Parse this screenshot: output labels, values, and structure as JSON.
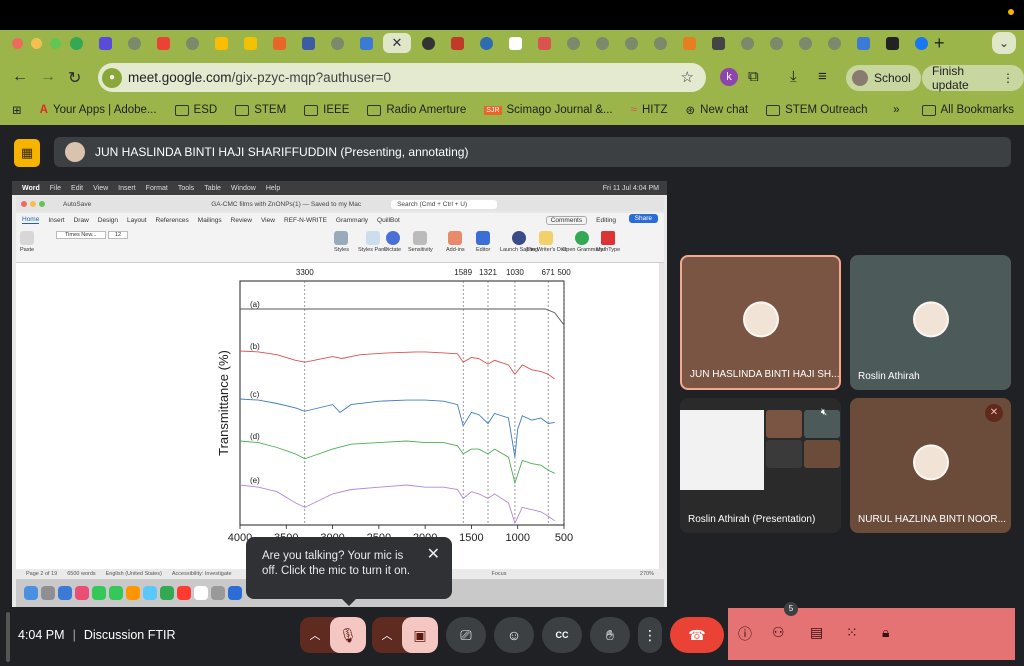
{
  "browser": {
    "url_host": "meet.google.com",
    "url_path": "/gix-pzyc-mqp?authuser=0",
    "profile_label": "School",
    "update_label": "Finish update",
    "extension_k": "k"
  },
  "bookmarks": [
    {
      "label": "Your Apps | Adobe..."
    },
    {
      "label": "ESD"
    },
    {
      "label": "STEM"
    },
    {
      "label": "IEEE"
    },
    {
      "label": "Radio Amerture"
    },
    {
      "label": "Scimago Journal &..."
    },
    {
      "label": "HITZ"
    },
    {
      "label": "New chat"
    },
    {
      "label": "STEM Outreach"
    }
  ],
  "bookmarks_more": "»",
  "all_bookmarks": "All Bookmarks",
  "presenting": {
    "label": "JUN HASLINDA BINTI HAJI SHARIFFUDDIN (Presenting, annotating)"
  },
  "shared_screen": {
    "mac_menu": [
      "Word",
      "File",
      "Edit",
      "View",
      "Insert",
      "Format",
      "Tools",
      "Table",
      "Window",
      "Help"
    ],
    "mac_clock": "Fri 11 Jul 4:04 PM",
    "doc_title": "GA-CMC films with ZnONPs(1) — Saved to my Mac",
    "autosave": "AutoSave",
    "search": "Search (Cmd + Ctrl + U)",
    "ribbon_tabs": [
      "Home",
      "Insert",
      "Draw",
      "Design",
      "Layout",
      "References",
      "Mailings",
      "Review",
      "View",
      "REF-N-WRITE",
      "Grammarly",
      "QuillBot"
    ],
    "comments": "Comments",
    "editing": "Editing",
    "share": "Share",
    "font_name": "Times New...",
    "font_size": "12",
    "ribbon_groups": [
      "Paste",
      "Styles",
      "Styles Pane",
      "Dictate",
      "Sensitivity",
      "Add-ins",
      "Editor",
      "Launch Sapling",
      "The Writer's Diet",
      "Open Grammary",
      "MathType"
    ],
    "status_page": "Page 2 of 19",
    "status_words": "6500 words",
    "status_lang": "English (United States)",
    "status_access": "Accessibility: Investigate",
    "status_focus": "Focus",
    "status_zoom": "270%"
  },
  "chart_data": {
    "type": "line",
    "title": "",
    "xlabel": "",
    "ylabel": "Transmittance (%)",
    "xlim": [
      4000,
      500
    ],
    "x_ticks": [
      4000,
      3500,
      3000,
      2500,
      2000,
      1500,
      1000,
      500
    ],
    "peak_markers": [
      3300,
      1589,
      1321,
      1030,
      671,
      500
    ],
    "series": [
      {
        "name": "(a)",
        "color": "#555555",
        "x": [
          4000,
          3500,
          3000,
          2500,
          2000,
          1500,
          1000,
          800,
          700,
          600,
          500
        ],
        "y": [
          0.93,
          0.93,
          0.93,
          0.93,
          0.93,
          0.93,
          0.93,
          0.93,
          0.93,
          0.9,
          0.8
        ]
      },
      {
        "name": "(b)",
        "color": "#d9534f",
        "x": [
          4000,
          3800,
          3600,
          3400,
          3300,
          3200,
          3000,
          2900,
          2700,
          2400,
          2100,
          2000,
          1800,
          1650,
          1589,
          1500,
          1420,
          1321,
          1250,
          1100,
          1030,
          950,
          850,
          750,
          671,
          600
        ],
        "y": [
          0.8,
          0.79,
          0.76,
          0.7,
          0.68,
          0.7,
          0.74,
          0.72,
          0.76,
          0.78,
          0.79,
          0.79,
          0.78,
          0.77,
          0.68,
          0.73,
          0.72,
          0.66,
          0.7,
          0.65,
          0.55,
          0.65,
          0.6,
          0.58,
          0.55,
          0.5
        ]
      },
      {
        "name": "(c)",
        "color": "#3d7cc9",
        "x": [
          4000,
          3800,
          3600,
          3400,
          3300,
          3200,
          3000,
          2920,
          2800,
          2500,
          2200,
          2000,
          1800,
          1650,
          1589,
          1500,
          1420,
          1321,
          1250,
          1100,
          1030,
          1000,
          950,
          850,
          750,
          671,
          600
        ],
        "y": [
          0.57,
          0.56,
          0.53,
          0.49,
          0.46,
          0.48,
          0.52,
          0.45,
          0.52,
          0.55,
          0.56,
          0.56,
          0.55,
          0.52,
          0.33,
          0.45,
          0.43,
          0.35,
          0.44,
          0.4,
          0.05,
          0.3,
          0.42,
          0.38,
          0.4,
          0.35,
          0.36
        ]
      },
      {
        "name": "(d)",
        "color": "#4caf50",
        "x": [
          4000,
          3800,
          3600,
          3400,
          3300,
          3200,
          3000,
          2800,
          2500,
          2200,
          2000,
          1800,
          1650,
          1589,
          1500,
          1420,
          1321,
          1250,
          1100,
          1030,
          950,
          850,
          750,
          671,
          600
        ],
        "y": [
          0.38,
          0.37,
          0.34,
          0.3,
          0.27,
          0.29,
          0.33,
          0.36,
          0.37,
          0.38,
          0.37,
          0.37,
          0.35,
          0.3,
          0.33,
          0.33,
          0.3,
          0.33,
          0.28,
          0.12,
          0.26,
          0.24,
          0.23,
          0.2,
          0.18
        ]
      },
      {
        "name": "(e)",
        "color": "#b388d6",
        "x": [
          4000,
          3800,
          3600,
          3400,
          3300,
          3200,
          3000,
          2800,
          2500,
          2200,
          2000,
          1800,
          1650,
          1589,
          1500,
          1420,
          1321,
          1250,
          1100,
          1030,
          950,
          850,
          750,
          671,
          600
        ],
        "y": [
          0.2,
          0.19,
          0.17,
          0.12,
          0.1,
          0.12,
          0.16,
          0.18,
          0.19,
          0.2,
          0.19,
          0.19,
          0.18,
          0.14,
          0.17,
          0.16,
          0.14,
          0.16,
          0.12,
          0.03,
          0.1,
          0.09,
          0.08,
          0.06,
          0.04
        ]
      }
    ]
  },
  "tiles": [
    {
      "name": "JUN HASLINDA BINTI HAJI SH...",
      "speaking": true
    },
    {
      "name": "Roslin Athirah"
    },
    {
      "name": "Roslin Athirah (Presentation)"
    },
    {
      "name": "NURUL HAZLINA BINTI NOOR..."
    }
  ],
  "tooltip": {
    "text": "Are you talking? Your mic is off. Click the mic to turn it on."
  },
  "bottom": {
    "time": "4:04 PM",
    "separator": "|",
    "meeting_name": "Discussion FTIR",
    "participant_count": "5"
  },
  "colors": {
    "chrome": "#9cb54a",
    "meet_bg": "#202124",
    "control_red": "#ea4335",
    "panel_red": "#e57373",
    "accent_yellow": "#f6b400"
  }
}
